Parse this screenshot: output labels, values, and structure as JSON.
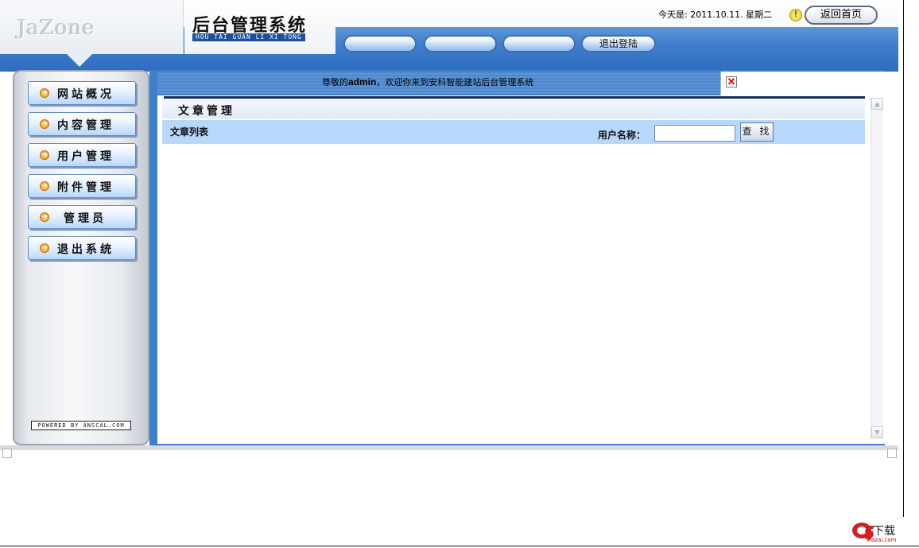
{
  "header": {
    "logo": "JaZone",
    "system_title": "后台管理系统",
    "system_subtitle": "HOU TAI GUAN LI XI TONG",
    "date_text": "今天是: 2011.10.11. 星期二",
    "home_button": "返回首页",
    "nav_buttons": [
      "",
      "",
      "",
      "退出登陆"
    ]
  },
  "sidebar": {
    "items": [
      {
        "label": "网站概况"
      },
      {
        "label": "内容管理"
      },
      {
        "label": "用户管理"
      },
      {
        "label": "附件管理"
      },
      {
        "label": "管理员"
      },
      {
        "label": "退出系统"
      }
    ],
    "powered_text": "POWERED BY ANSCAL.COM"
  },
  "main": {
    "welcome_prefix": "尊敬的",
    "welcome_user": "admin",
    "welcome_suffix": "，欢迎你来到安科智能建站后台管理系统",
    "section_title": "文章管理",
    "list_title": "文章列表",
    "search": {
      "label": "用户名称：",
      "value": "",
      "button": "查 找"
    }
  },
  "watermark": {
    "brand": "a5",
    "text": "下载",
    "sub": "xiazai.com"
  },
  "colors": {
    "header_blue": "#3f7ecb",
    "list_bar_blue": "#b8d8fb",
    "dark_divider": "#0d2f62"
  }
}
